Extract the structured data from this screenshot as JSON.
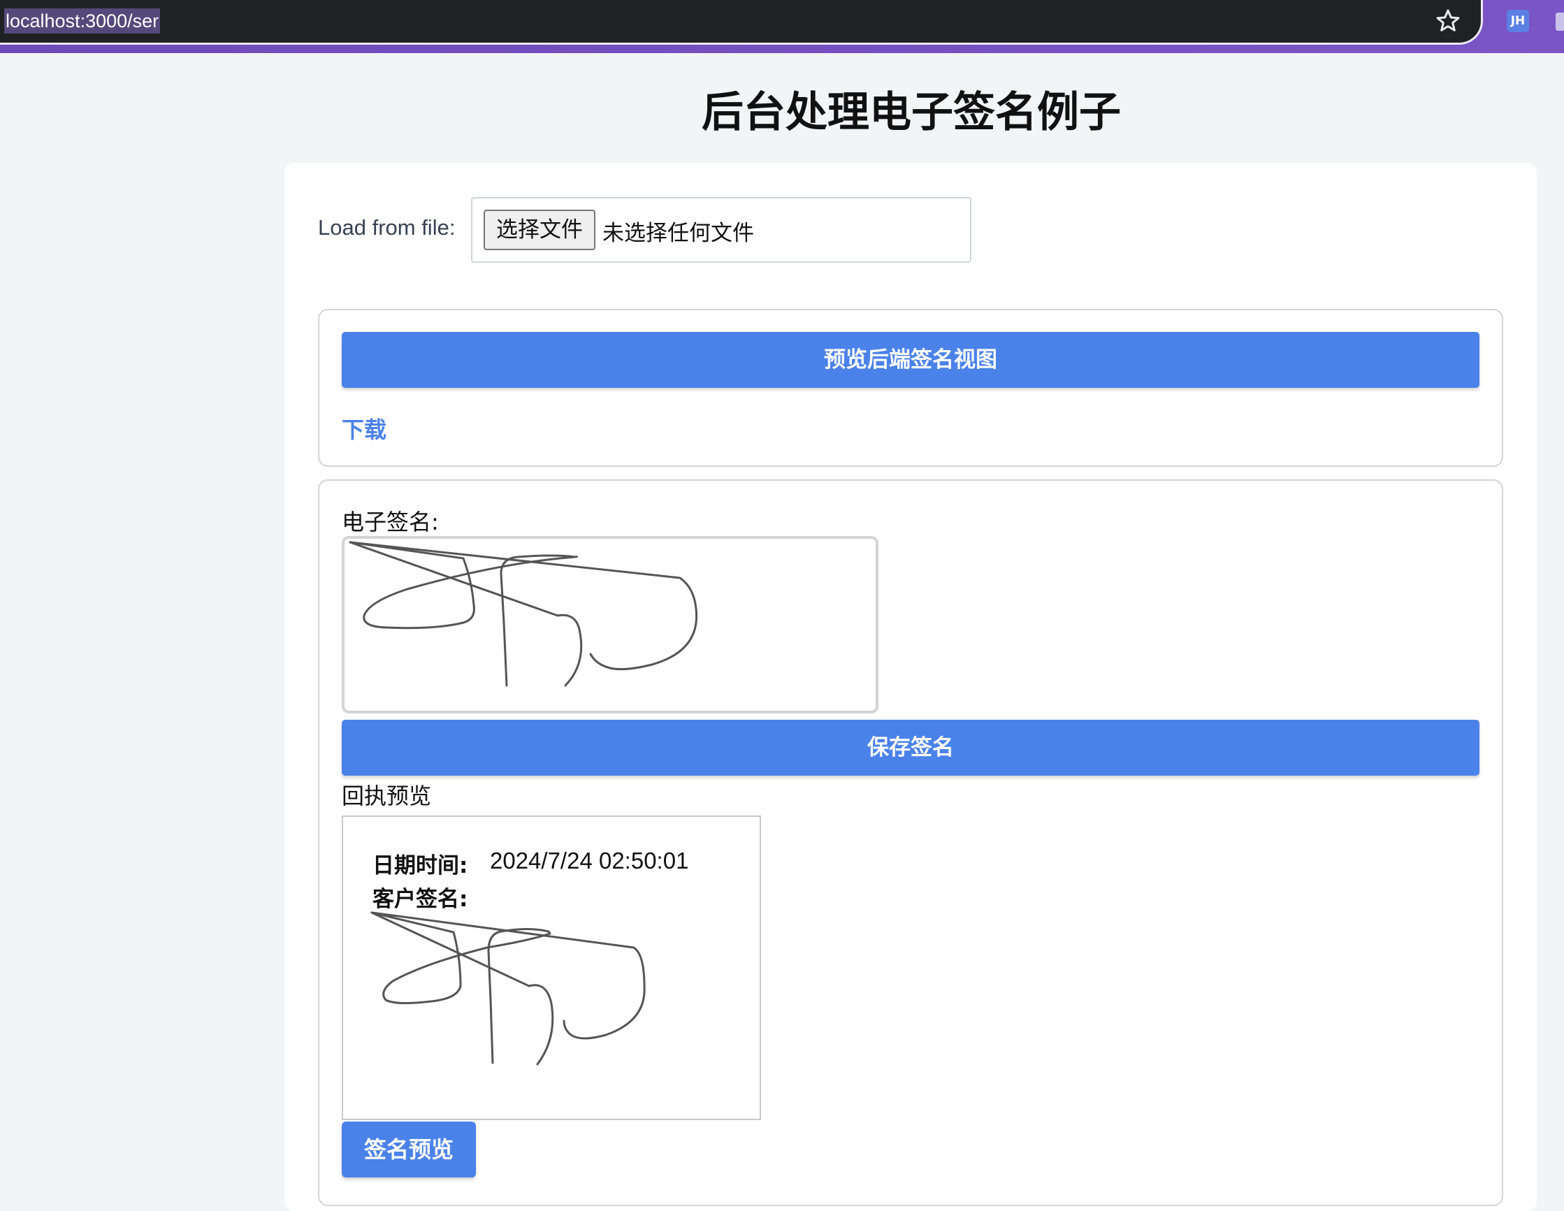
{
  "browser": {
    "url": "localhost:3000/ser",
    "extension_badge": "JH"
  },
  "page": {
    "title": "后台处理电子签名例子"
  },
  "file_input": {
    "label": "Load from file:",
    "button_label": "选择文件",
    "status": "未选择任何文件"
  },
  "backend_panel": {
    "preview_button": "预览后端签名视图",
    "download_link": "下载"
  },
  "signature_panel": {
    "signature_label": "电子签名:",
    "save_button": "保存签名",
    "receipt_label": "回执预览",
    "receipt": {
      "datetime_label": "日期时间:",
      "datetime_value": "2024/7/24 02:50:01",
      "customer_signature_label": "客户签名:"
    },
    "preview_button": "签名预览"
  },
  "colors": {
    "primary": "#4b82ea",
    "page_background": "#f3f4f6",
    "browser_chrome": "#202124",
    "accent_purple": "#6d4bb8"
  }
}
